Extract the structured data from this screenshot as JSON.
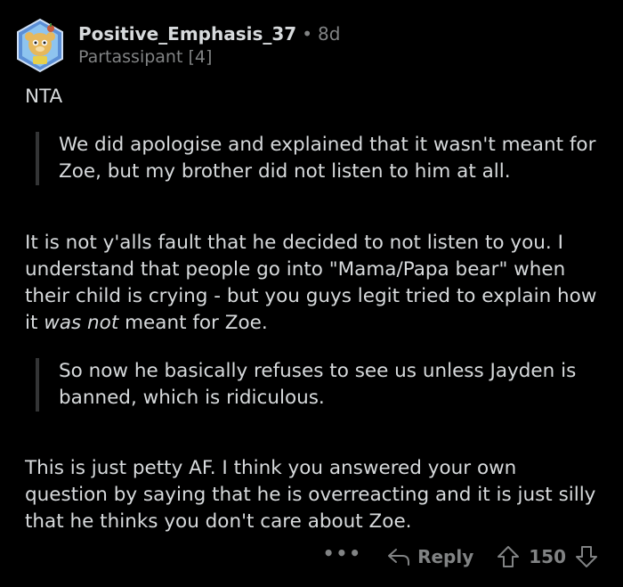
{
  "comment": {
    "username": "Positive_Emphasis_37",
    "separator": "•",
    "age": "8d",
    "flair": "Partassipant [4]",
    "paragraphs": {
      "nta": "NTA",
      "quote1": "We did apologise and explained that it wasn't meant for Zoe, but my brother did not listen to him at all.",
      "p2_before": "It is not y'alls fault that he decided to not listen to you. I understand that people go into \"Mama/Papa bear\" when their child is crying - but you guys legit tried to explain how it ",
      "p2_emph": "was not",
      "p2_after": " meant for Zoe.",
      "quote2": "So now he basically refuses to see us unless Jayden is banned, which is ridiculous.",
      "p3": "This is just petty AF. I think you answered your own question by saying that he is overreacting and it is just silly that he thinks you don't care about Zoe."
    },
    "actions": {
      "more_label": "•••",
      "reply_label": "Reply",
      "score": "150"
    }
  },
  "colors": {
    "background": "#000000",
    "text": "#d7dadc",
    "meta": "#818384",
    "quote_bar": "#343536"
  },
  "icons": {
    "avatar": "snoo-avatar-icon",
    "reply": "reply-arrow-icon",
    "upvote": "upvote-arrow-icon",
    "downvote": "downvote-arrow-icon"
  }
}
